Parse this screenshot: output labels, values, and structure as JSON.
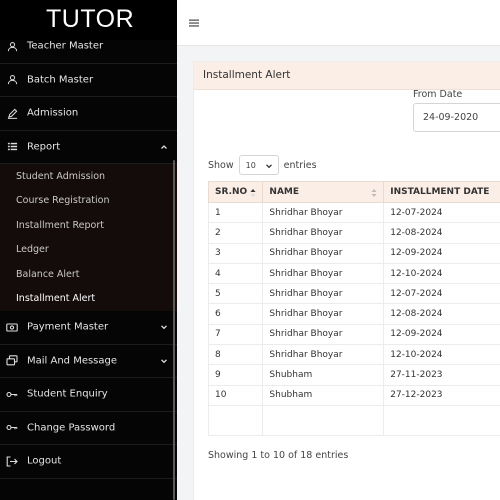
{
  "brand": {
    "logo": "TUTOR"
  },
  "sidebar": {
    "items": [
      {
        "label": "Teacher Master"
      },
      {
        "label": "Batch Master"
      },
      {
        "label": "Admission"
      },
      {
        "label": "Report"
      },
      {
        "label": "Payment Master"
      },
      {
        "label": "Mail And Message"
      },
      {
        "label": "Student Enquiry"
      },
      {
        "label": "Change Password"
      },
      {
        "label": "Logout"
      }
    ],
    "report_sub": [
      "Student Admission",
      "Course Registration",
      "Installment Report",
      "Ledger",
      "Balance Alert",
      "Installment Alert"
    ]
  },
  "card": {
    "title": "Installment Alert",
    "from_label": "From Date",
    "from_value": "24-09-2020"
  },
  "length": {
    "show": "Show",
    "value": "10",
    "entries": "entries"
  },
  "table": {
    "headers": [
      "SR.NO",
      "NAME",
      "INSTALLMENT DATE"
    ],
    "rows": [
      [
        "1",
        "Shridhar Bhoyar",
        "12-07-2024"
      ],
      [
        "2",
        "Shridhar Bhoyar",
        "12-08-2024"
      ],
      [
        "3",
        "Shridhar Bhoyar",
        "12-09-2024"
      ],
      [
        "4",
        "Shridhar Bhoyar",
        "12-10-2024"
      ],
      [
        "5",
        "Shridhar Bhoyar",
        "12-07-2024"
      ],
      [
        "6",
        "Shridhar Bhoyar",
        "12-08-2024"
      ],
      [
        "7",
        "Shridhar Bhoyar",
        "12-09-2024"
      ],
      [
        "8",
        "Shridhar Bhoyar",
        "12-10-2024"
      ],
      [
        "9",
        "Shubham",
        "27-11-2023"
      ],
      [
        "10",
        "Shubham",
        "27-12-2023"
      ]
    ],
    "info": "Showing 1 to 10 of 18 entries"
  }
}
